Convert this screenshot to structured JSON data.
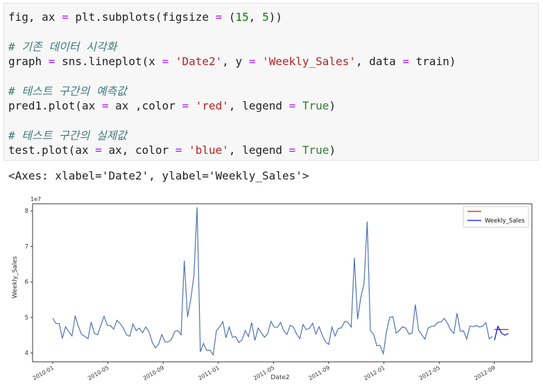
{
  "code": {
    "line1": {
      "a": "fig, ax ",
      "b": "=",
      "c": " plt.subplots(figsize ",
      "d": "=",
      "e": " (",
      "f": "15",
      "g": ", ",
      "h": "5",
      "i": "))"
    },
    "comment1": "# 기존 데이터 시각화",
    "line2": {
      "a": "graph ",
      "b": "=",
      "c": " sns.lineplot(x ",
      "d": "=",
      "e": " ",
      "f": "'Date2'",
      "g": ", y ",
      "h": "=",
      "i": " ",
      "j": "'Weekly_Sales'",
      "k": ", data ",
      "l": "=",
      "m": " train)"
    },
    "comment2": "# 테스트 구간의 예측값",
    "line3": {
      "a": "pred1.plot(ax ",
      "b": "=",
      "c": " ax ,color ",
      "d": "=",
      "e": " ",
      "f": "'red'",
      "g": ", legend ",
      "h": "=",
      "i": " ",
      "j": "True",
      "k": ")"
    },
    "comment3": "# 테스트 구간의 실제값",
    "line4": {
      "a": "test.plot(ax ",
      "b": "=",
      "c": " ax, color ",
      "d": "=",
      "e": " ",
      "f": "'blue'",
      "g": ", legend ",
      "h": "=",
      "i": " ",
      "j": "True",
      "k": ")"
    }
  },
  "output_text": "<Axes: xlabel='Date2', ylabel='Weekly_Sales'>",
  "chart_data": {
    "type": "line",
    "xlabel": "Date2",
    "ylabel": "Weekly_Sales",
    "offset_label": "1e7",
    "x_tick_labels": [
      "2010-01",
      "2010-05",
      "2010-09",
      "2011-01",
      "2011-05",
      "2011-09",
      "2012-01",
      "2012-05",
      "2012-09"
    ],
    "y_tick_labels": [
      "4",
      "5",
      "6",
      "7",
      "8"
    ],
    "ylim": [
      3.75,
      8.2
    ],
    "legend_placement": "top-right",
    "legend": [
      {
        "label": "",
        "color": "#ff0000"
      },
      {
        "label": "Weekly_Sales",
        "color": "#0000ff"
      }
    ],
    "series": [
      {
        "color": "#4c72b0",
        "y": [
          4.98,
          4.83,
          4.83,
          4.41,
          4.74,
          4.6,
          4.48,
          5.05,
          4.75,
          4.52,
          4.47,
          4.4,
          4.87,
          4.55,
          4.51,
          4.78,
          5.03,
          4.78,
          4.77,
          4.67,
          4.92,
          4.83,
          4.7,
          4.51,
          4.47,
          4.82,
          4.63,
          4.7,
          4.57,
          4.73,
          4.6,
          4.3,
          4.14,
          4.25,
          4.52,
          4.31,
          4.31,
          4.38,
          4.6,
          4.63,
          4.51,
          6.6,
          5.01,
          5.5,
          6.17,
          8.1,
          4.03,
          4.27,
          4.07,
          4.08,
          3.95,
          4.62,
          4.73,
          4.88,
          4.43,
          4.73,
          4.44,
          4.46,
          4.29,
          4.37,
          4.63,
          4.46,
          4.86,
          4.35,
          4.7,
          4.57,
          4.44,
          4.55,
          4.89,
          4.73,
          4.72,
          4.86,
          4.62,
          4.52,
          4.78,
          4.73,
          4.53,
          4.4,
          4.8,
          4.66,
          4.69,
          4.84,
          4.53,
          4.74,
          4.5,
          4.31,
          4.24,
          4.73,
          4.48,
          4.69,
          4.71,
          4.89,
          4.86,
          4.73,
          6.68,
          4.95,
          5.57,
          5.95,
          7.7,
          4.63,
          4.52,
          4.2,
          4.22,
          3.98,
          4.6,
          5.0,
          5.02,
          4.56,
          4.63,
          4.74,
          4.7,
          4.53,
          4.56,
          5.36,
          4.64,
          4.51,
          4.39,
          4.7,
          4.75,
          4.76,
          4.86,
          4.87,
          4.97,
          4.84,
          4.65,
          4.55,
          5.12,
          4.61,
          4.62,
          4.39,
          4.76,
          4.74,
          4.77,
          4.73,
          4.76,
          4.85,
          4.4,
          4.46
        ]
      },
      {
        "color": "#ff0000",
        "y": [
          4.66,
          4.66,
          4.66,
          4.66,
          4.66
        ]
      },
      {
        "color": "#0000ff",
        "y": [
          4.36,
          4.75,
          4.56,
          4.5,
          4.55
        ]
      }
    ]
  }
}
